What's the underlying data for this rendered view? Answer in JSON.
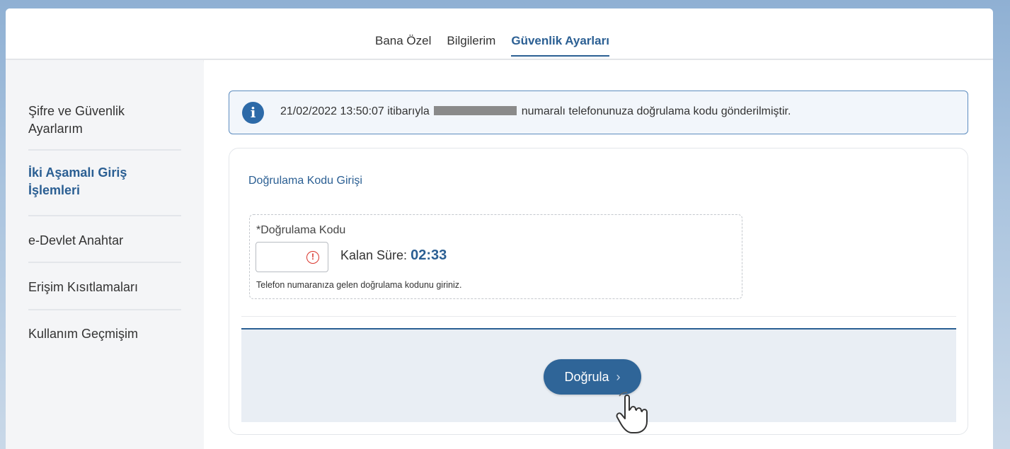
{
  "tabs": [
    {
      "label": "Bana Özel"
    },
    {
      "label": "Bilgilerim"
    },
    {
      "label": "Güvenlik Ayarları",
      "active": true
    }
  ],
  "sidebar": {
    "items": [
      {
        "label": "Şifre ve Güvenlik Ayarlarım"
      },
      {
        "label": "İki Aşamalı Giriş İşlemleri",
        "active": true
      },
      {
        "label": "e-Devlet Anahtar"
      },
      {
        "label": "Erişim Kısıtlamaları"
      },
      {
        "label": "Kullanım Geçmişim"
      }
    ]
  },
  "alert": {
    "icon": "info-icon",
    "text_before": "21/02/2022 13:50:07 itibarıyla",
    "text_after": "numaralı telefonunuza doğrulama kodu gönderilmiştir."
  },
  "form": {
    "title": "Doğrulama Kodu Girişi",
    "field_label": "*Doğrulama Kodu",
    "field_value": "",
    "warning_icon": "exclamation-circle-icon",
    "timer_label": "Kalan Süre:",
    "timer_value": "02:33",
    "help_text": "Telefon numaranıza gelen doğrulama kodunu giriniz."
  },
  "actions": {
    "verify_label": "Doğrula",
    "verify_icon": "chevron-right-icon",
    "cursor_icon": "hand-pointer-icon"
  },
  "colors": {
    "accent": "#2b5f93",
    "button": "#2f6598",
    "warning": "#d9342b",
    "info_bg": "#f2f6fb"
  }
}
